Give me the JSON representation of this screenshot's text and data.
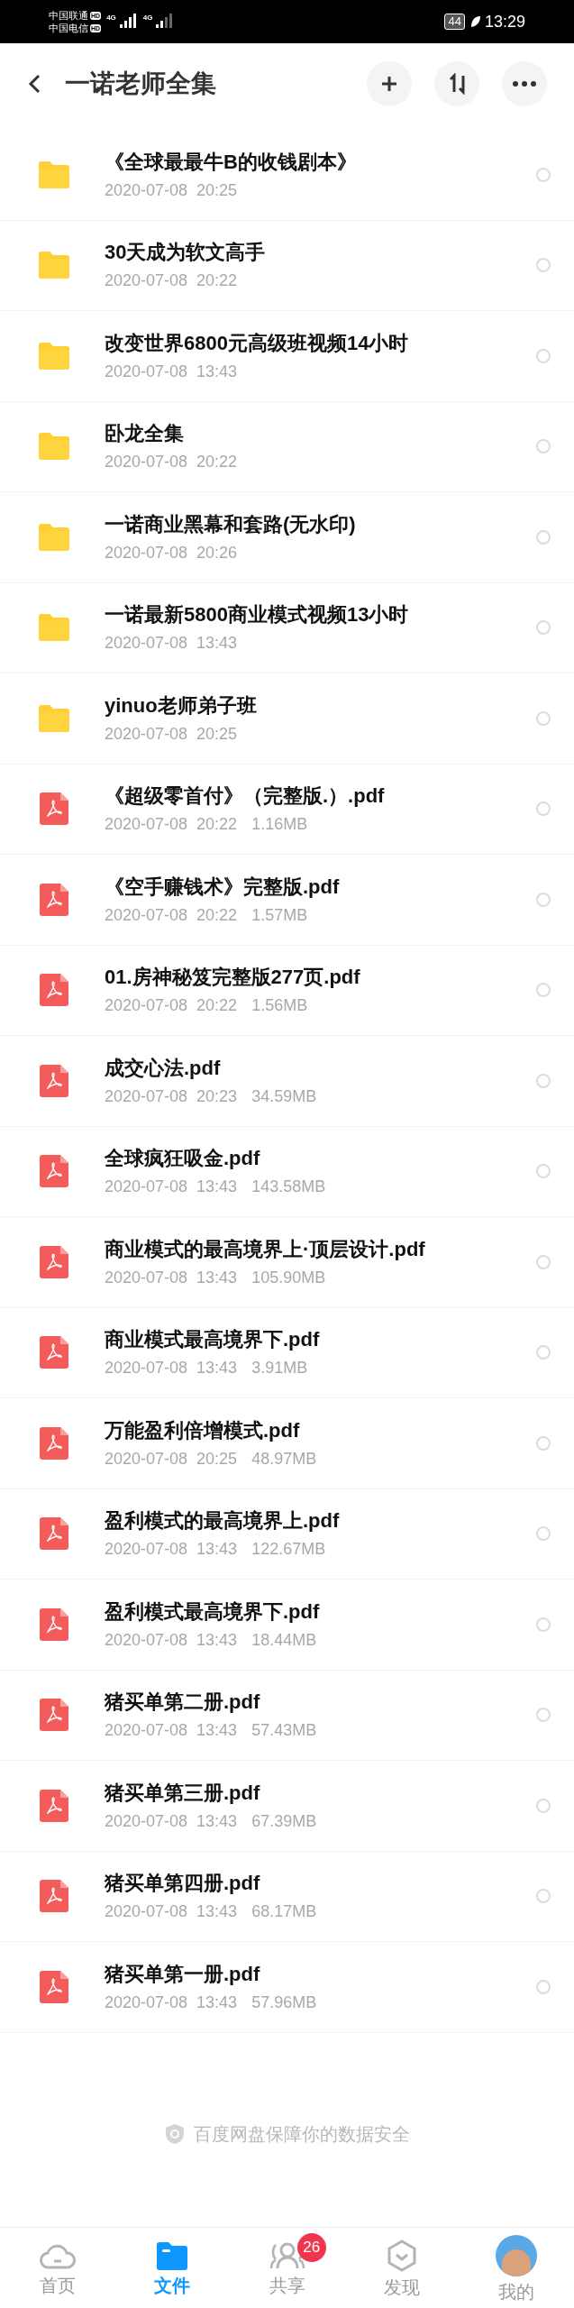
{
  "status_bar": {
    "carriers": [
      {
        "name": "中国联通",
        "badge": "HD"
      },
      {
        "name": "中国电信",
        "badge": "HD"
      }
    ],
    "networks": [
      {
        "label": "4G"
      },
      {
        "label": "4G"
      }
    ],
    "battery": "44",
    "time": "13:29"
  },
  "header": {
    "title": "一诺老师全集"
  },
  "files": [
    {
      "kind": "folder",
      "name": "《全球最最牛B的收钱剧本》",
      "date": "2020-07-08  20:25",
      "selected": false
    },
    {
      "kind": "folder",
      "name": "30天成为软文高手",
      "date": "2020-07-08  20:22",
      "selected": false
    },
    {
      "kind": "folder",
      "name": "改变世界6800元高级班视频14小时",
      "date": "2020-07-08  13:43",
      "selected": false
    },
    {
      "kind": "folder",
      "name": "卧龙全集",
      "date": "2020-07-08  20:22",
      "selected": false
    },
    {
      "kind": "folder",
      "name": "一诺商业黑幕和套路(无水印)",
      "date": "2020-07-08  20:26",
      "selected": false
    },
    {
      "kind": "folder",
      "name": "一诺最新5800商业模式视频13小时",
      "date": "2020-07-08  13:43",
      "selected": false
    },
    {
      "kind": "folder",
      "name": "yinuo老师弟子班",
      "date": "2020-07-08  20:25",
      "selected": false
    },
    {
      "kind": "pdf",
      "name": "《超级零首付》（完整版.）.pdf",
      "date": "2020-07-08  20:22",
      "size": "1.16MB",
      "selected": false
    },
    {
      "kind": "pdf",
      "name": "《空手赚钱术》完整版.pdf",
      "date": "2020-07-08  20:22",
      "size": "1.57MB",
      "selected": false
    },
    {
      "kind": "pdf",
      "name": "01.房神秘笈完整版277页.pdf",
      "date": "2020-07-08  20:22",
      "size": "1.56MB",
      "selected": false
    },
    {
      "kind": "pdf",
      "name": "成交心法.pdf",
      "date": "2020-07-08  20:23",
      "size": "34.59MB",
      "selected": false
    },
    {
      "kind": "pdf",
      "name": "全球疯狂吸金.pdf",
      "date": "2020-07-08  13:43",
      "size": "143.58MB",
      "selected": false
    },
    {
      "kind": "pdf",
      "name": "商业模式的最高境界上·顶层设计.pdf",
      "date": "2020-07-08  13:43",
      "size": "105.90MB",
      "selected": false
    },
    {
      "kind": "pdf",
      "name": "商业模式最高境界下.pdf",
      "date": "2020-07-08  13:43",
      "size": "3.91MB",
      "selected": false
    },
    {
      "kind": "pdf",
      "name": "万能盈利倍增模式.pdf",
      "date": "2020-07-08  20:25",
      "size": "48.97MB",
      "selected": false
    },
    {
      "kind": "pdf",
      "name": "盈利模式的最高境界上.pdf",
      "date": "2020-07-08  13:43",
      "size": "122.67MB",
      "selected": false
    },
    {
      "kind": "pdf",
      "name": "盈利模式最高境界下.pdf",
      "date": "2020-07-08  13:43",
      "size": "18.44MB",
      "selected": false
    },
    {
      "kind": "pdf",
      "name": "猪买单第二册.pdf",
      "date": "2020-07-08  13:43",
      "size": "57.43MB",
      "selected": false
    },
    {
      "kind": "pdf",
      "name": "猪买单第三册.pdf",
      "date": "2020-07-08  13:43",
      "size": "67.39MB",
      "selected": false
    },
    {
      "kind": "pdf",
      "name": "猪买单第四册.pdf",
      "date": "2020-07-08  13:43",
      "size": "68.17MB",
      "selected": false
    },
    {
      "kind": "pdf",
      "name": "猪买单第一册.pdf",
      "date": "2020-07-08  13:43",
      "size": "57.96MB",
      "selected": false
    }
  ],
  "footer_note": "百度网盘保障你的数据安全",
  "tabs": [
    {
      "kind": "home",
      "label": "首页",
      "selected": false
    },
    {
      "kind": "files",
      "label": "文件",
      "selected": true
    },
    {
      "kind": "share",
      "label": "共享",
      "selected": false,
      "badge": "26"
    },
    {
      "kind": "discover",
      "label": "发现",
      "selected": false
    },
    {
      "kind": "me",
      "label": "我的",
      "selected": false
    }
  ]
}
